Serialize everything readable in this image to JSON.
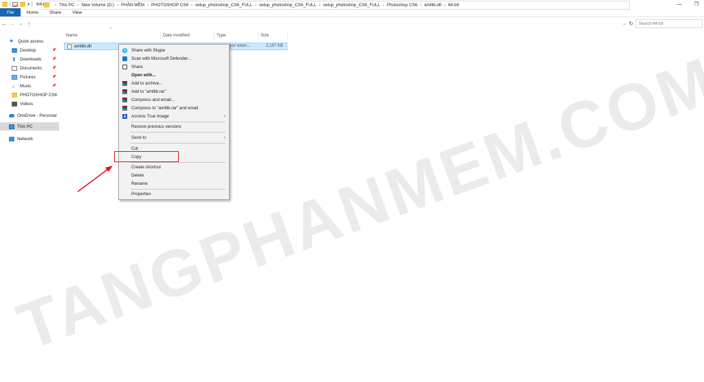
{
  "window": {
    "title": "64-bit",
    "qat_dropdown": "▾",
    "minimize": "—",
    "maximize": "❐",
    "close": "✕"
  },
  "ribbon": {
    "tabs": [
      {
        "label": "File",
        "active": true
      },
      {
        "label": "Home"
      },
      {
        "label": "Share"
      },
      {
        "label": "View"
      }
    ]
  },
  "nav_buttons": {
    "back": "←",
    "forward": "→",
    "recent": "⌄",
    "up": "↑"
  },
  "address": {
    "crumbs": [
      "This PC",
      "New Volume (D:)",
      "PHẦN MỀM",
      "PHOTOSHOP CS6",
      "setup_photoshop_CS6_FULL",
      "setup_photoshop_CS6_FULL",
      "setup_photoshop_CS6_FULL",
      "Photoshop CS6",
      "amtlib.dll",
      "64-bit"
    ],
    "separator": "›",
    "dropdown": "⌄",
    "refresh": "↻",
    "search_placeholder": "Search 64-bit"
  },
  "sidebar": {
    "items": [
      {
        "label": "Quick access",
        "icon": "star-icon",
        "glyph": "★",
        "pinned": false
      },
      {
        "label": "Desktop",
        "icon": "desktop-icon",
        "pinned": true
      },
      {
        "label": "Downloads",
        "icon": "download-icon",
        "glyph": "⬇",
        "pinned": true
      },
      {
        "label": "Documents",
        "icon": "documents-icon",
        "pinned": true
      },
      {
        "label": "Pictures",
        "icon": "pictures-icon",
        "pinned": true
      },
      {
        "label": "Music",
        "icon": "music-icon",
        "glyph": "♪",
        "pinned": true
      },
      {
        "label": "PHOTOSHOP CS6",
        "icon": "folder-icon",
        "pinned": false
      },
      {
        "label": "Videos",
        "icon": "videos-icon",
        "pinned": false
      },
      {
        "label": "OneDrive - Personal",
        "icon": "onedrive-icon",
        "pinned": false
      },
      {
        "label": "This PC",
        "icon": "this-pc-icon",
        "pinned": false,
        "selected": true
      },
      {
        "label": "Network",
        "icon": "network-icon",
        "pinned": false
      }
    ],
    "pin_glyph": "📌"
  },
  "columns": {
    "sort_caret": "^",
    "headers": [
      "Name",
      "Date modified",
      "Type",
      "Size"
    ]
  },
  "files": [
    {
      "name": "amtlib.dll",
      "type": "ation exten...",
      "size": "2,197 KB"
    }
  ],
  "context_menu": {
    "items": [
      {
        "label": "Share with Skype",
        "icon": "skype-icon",
        "glyph": "S"
      },
      {
        "label": "Scan with Microsoft Defender...",
        "icon": "defender-icon"
      },
      {
        "label": "Share",
        "icon": "share-icon"
      },
      {
        "label": "Open with...",
        "bold": true
      },
      {
        "label": "Add to archive...",
        "icon": "winrar-icon"
      },
      {
        "label": "Add to \"amtlib.rar\"",
        "icon": "winrar-icon"
      },
      {
        "label": "Compress and email...",
        "icon": "winrar-icon"
      },
      {
        "label": "Compress to \"amtlib.rar\" and email",
        "icon": "winrar-icon"
      },
      {
        "label": "Acronis True Image",
        "icon": "acronis-icon",
        "glyph": "A",
        "submenu": true
      },
      {
        "label": "Restore previous versions"
      },
      {
        "label": "Send to",
        "submenu": true
      },
      {
        "label": "Cut"
      },
      {
        "label": "Copy",
        "highlighted": true
      },
      {
        "label": "Create shortcut"
      },
      {
        "label": "Delete"
      },
      {
        "label": "Rename"
      },
      {
        "label": "Properties"
      }
    ],
    "submenu_glyph": "›"
  },
  "watermark": "TANGPHANMEM.COM",
  "colors": {
    "accent": "#1a66b4",
    "selection": "#cce8ff",
    "highlight_box": "#e1141b",
    "arrow": "#e1141b"
  }
}
